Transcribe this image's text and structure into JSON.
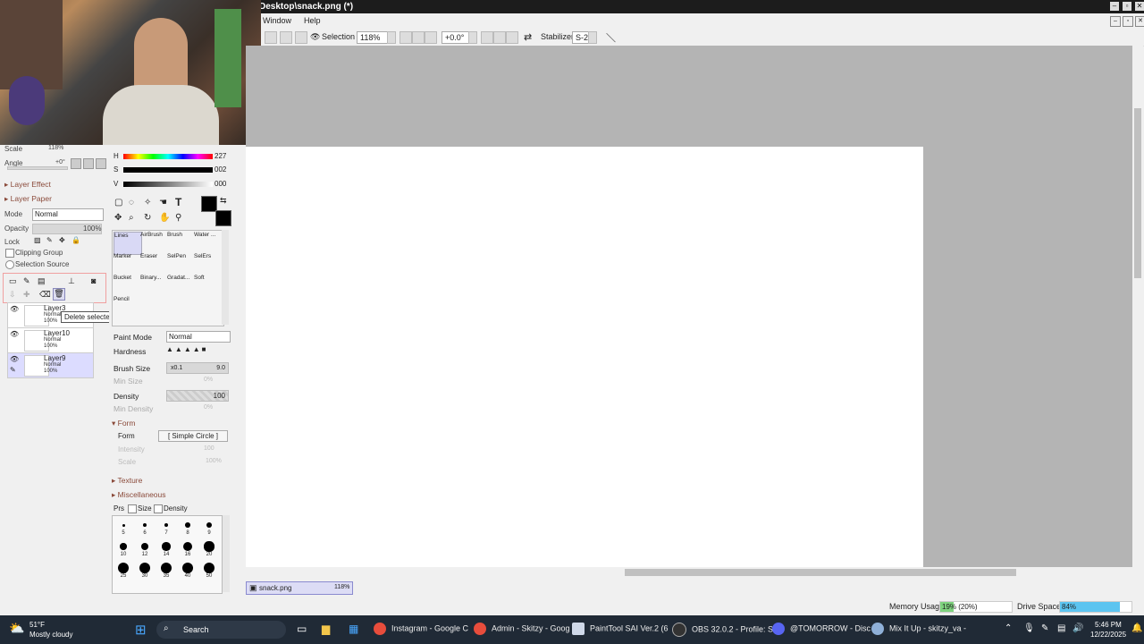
{
  "window": {
    "title": "Desktop\\snack.png (*)"
  },
  "menu": {
    "items": [
      "Window",
      "Help"
    ]
  },
  "toolbar": {
    "selection_label": "Selection",
    "zoom": "118%",
    "rotation": "+0.0°",
    "stabilizer_label": "Stabilizer",
    "stabilizer_value": "S-2"
  },
  "navigator": {
    "scale_label": "Scale",
    "scale_value": "118%",
    "angle_label": "Angle",
    "angle_value": "+0°"
  },
  "layer_panel": {
    "layer_effect": "Layer Effect",
    "layer_paper": "Layer Paper",
    "mode_label": "Mode",
    "mode_value": "Normal",
    "opacity_label": "Opacity",
    "opacity_value": "100%",
    "lock_label": "Lock",
    "clipping_group": "Clipping Group",
    "selection_source": "Selection Source",
    "tooltip": "Delete selected layers.",
    "layers": [
      {
        "name": "Layer3",
        "mode": "Normal",
        "opacity": "100%"
      },
      {
        "name": "Layer10",
        "mode": "Normal",
        "opacity": "100%"
      },
      {
        "name": "Layer9",
        "mode": "Normal",
        "opacity": "100%"
      }
    ]
  },
  "color": {
    "h_label": "H",
    "h_value": "227",
    "s_label": "S",
    "s_value": "002",
    "v_label": "V",
    "v_value": "000"
  },
  "brushes": [
    {
      "name": "Lines"
    },
    {
      "name": "AirBrush"
    },
    {
      "name": "Brush"
    },
    {
      "name": "Water ..."
    },
    {
      "name": "Marker"
    },
    {
      "name": "Eraser"
    },
    {
      "name": "SelPen"
    },
    {
      "name": "SelErs"
    },
    {
      "name": "Bucket"
    },
    {
      "name": "Binary..."
    },
    {
      "name": "Gradat..."
    },
    {
      "name": "Soft"
    },
    {
      "name": "Pencil"
    }
  ],
  "tool_settings": {
    "paint_mode_label": "Paint Mode",
    "paint_mode_value": "Normal",
    "hardness_label": "Hardness",
    "brush_size_label": "Brush Size",
    "brush_size_mult": "x0.1",
    "brush_size_value": "9.0",
    "min_size_label": "Min Size",
    "min_size_value": "0%",
    "density_label": "Density",
    "density_value": "100",
    "min_density_label": "Min Density",
    "min_density_value": "0%",
    "form_section": "Form",
    "form_label": "Form",
    "form_value": "[ Simple Circle ]",
    "intensity_label": "Intensity",
    "intensity_value": "100",
    "scale_label": "Scale",
    "scale_value": "100%",
    "texture_section": "Texture",
    "misc_section": "Miscellaneous",
    "prs_label": "Prs",
    "size_label": "Size",
    "density_check_label": "Density",
    "sizes": [
      "5",
      "6",
      "7",
      "8",
      "9",
      "10",
      "12",
      "14",
      "16",
      "20",
      "25",
      "30",
      "35",
      "40",
      "50"
    ]
  },
  "document": {
    "name": "snack.png",
    "zoom": "118%"
  },
  "status": {
    "memory_label": "Memory Usage",
    "memory_value": "19% (20%)",
    "memory_pct": 19,
    "drive_label": "Drive Space",
    "drive_value": "84%",
    "drive_pct": 84
  },
  "taskbar": {
    "weather_temp": "51°F",
    "weather_desc": "Mostly cloudy",
    "search": "Search",
    "apps": [
      "Instagram - Google C",
      "Admin - Skitzy - Goog",
      "PaintTool SAI Ver.2 (6",
      "OBS 32.0.2 - Profile: S",
      "@TOMORROW - Disc",
      "Mix It Up - skitzy_va -"
    ],
    "time": "5:46 PM",
    "date": "12/22/2025"
  }
}
